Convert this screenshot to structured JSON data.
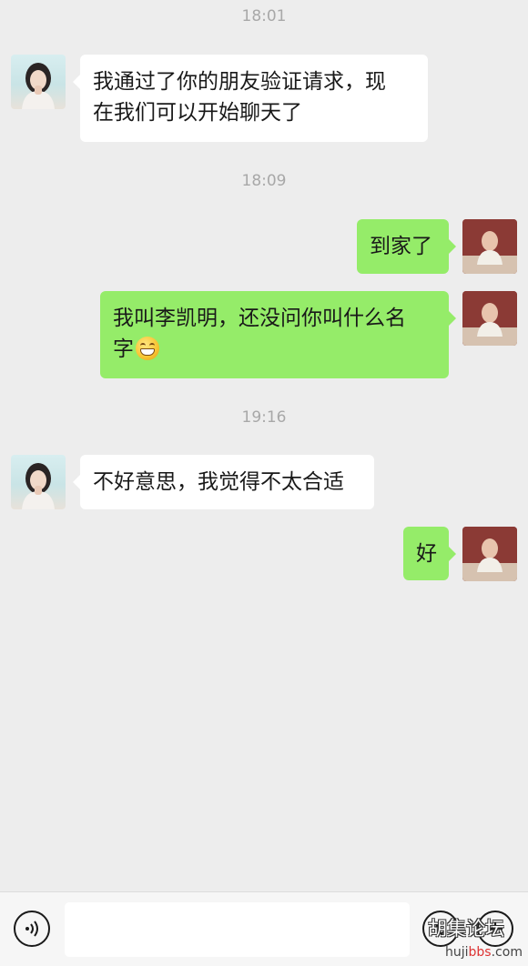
{
  "messages": [
    {
      "type": "time",
      "text": "18:01"
    },
    {
      "type": "incoming",
      "lines": [
        "我通过了你的朋友验证请求，现",
        "在我们可以开始聊天了"
      ]
    },
    {
      "type": "time",
      "text": "18:09"
    },
    {
      "type": "outgoing",
      "lines": [
        "到家了"
      ]
    },
    {
      "type": "outgoing",
      "lines": [
        "我叫李凯明，还没问你叫什么名",
        "字"
      ],
      "emoji": "grinning-face-emoji"
    },
    {
      "type": "time",
      "text": "19:16"
    },
    {
      "type": "incoming",
      "lines": [
        "不好意思，我觉得不太合适"
      ]
    },
    {
      "type": "outgoing",
      "lines": [
        "好"
      ]
    }
  ],
  "input": {
    "value": "",
    "placeholder": ""
  },
  "icons": {
    "voice": "voice-input-icon",
    "emoji": "emoji-icon",
    "more": "plus-more-icon"
  },
  "colors": {
    "background": "#ededed",
    "outgoing_bubble": "#95ec69",
    "incoming_bubble": "#ffffff"
  },
  "watermark": {
    "text": "胡集论坛",
    "url_pre": "huji",
    "url_hl": "bbs",
    "url_post": ".com"
  }
}
